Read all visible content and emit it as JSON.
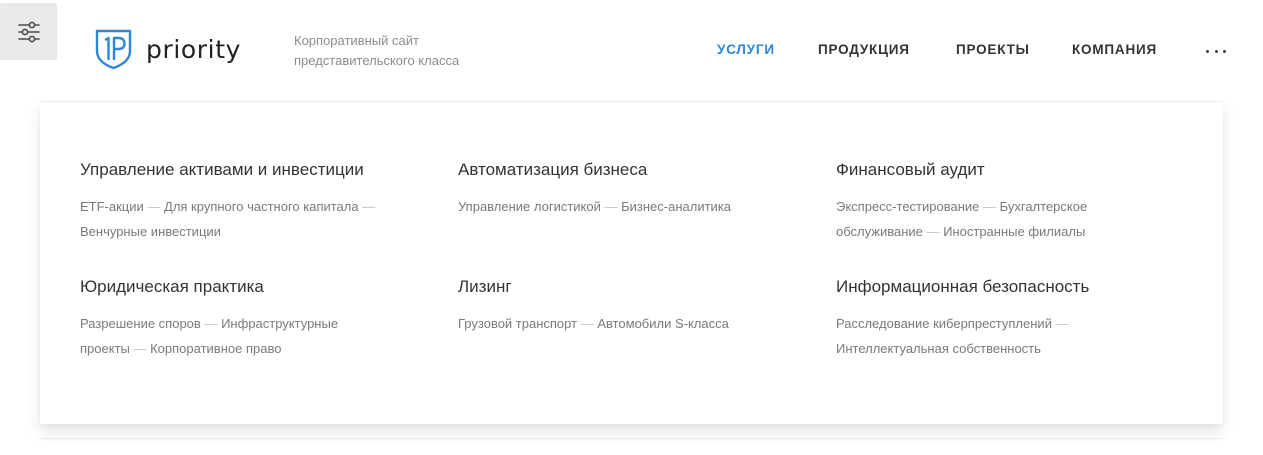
{
  "header": {
    "logo_text": "priority",
    "tagline": "Корпоративный сайт представительского класса",
    "nav": [
      {
        "label": "УСЛУГИ",
        "active": true
      },
      {
        "label": "ПРОДУКЦИЯ",
        "active": false
      },
      {
        "label": "ПРОЕКТЫ",
        "active": false
      },
      {
        "label": "КОМПАНИЯ",
        "active": false
      }
    ],
    "more_icon": "more-dots-icon",
    "settings_icon": "sliders-icon"
  },
  "colors": {
    "accent": "#2d87d6",
    "text": "#333333",
    "muted": "#7a7a7a"
  },
  "menu": {
    "sections": [
      {
        "title": "Управление активами и инвестиции",
        "links": [
          "ETF-акции",
          "Для крупного частного капитала",
          "Венчурные инвестиции"
        ]
      },
      {
        "title": "Автоматизация бизнеса",
        "links": [
          "Управление логистикой",
          "Бизнес-аналитика"
        ]
      },
      {
        "title": "Финансовый аудит",
        "links": [
          "Экспресс-тестирование",
          "Бухгалтерское обслуживание",
          "Иностранные филиалы"
        ]
      },
      {
        "title": "Юридическая практика",
        "links": [
          "Разрешение споров",
          "Инфраструктурные проекты",
          "Корпоративное право"
        ]
      },
      {
        "title": "Лизинг",
        "links": [
          "Грузовой транспорт",
          "Автомобили S-класса"
        ]
      },
      {
        "title": "Информационная безопасность",
        "links": [
          "Расследование киберпреступлений",
          "Интеллектуальная собственность"
        ]
      }
    ]
  }
}
